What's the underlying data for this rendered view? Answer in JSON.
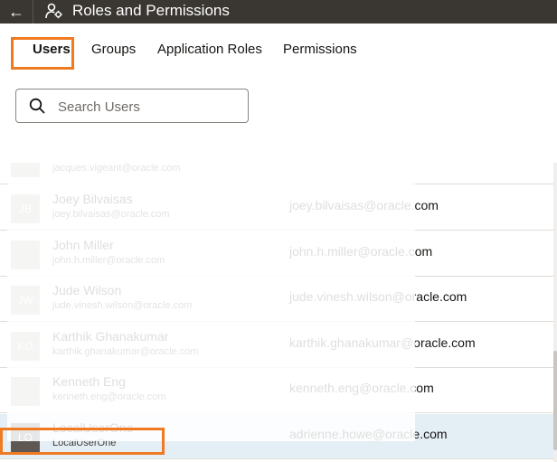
{
  "header": {
    "title": "Roles and Permissions",
    "back_icon": "arrow-left-icon",
    "title_icon": "roles-icon"
  },
  "tabs": [
    {
      "label": "Users",
      "active": true
    },
    {
      "label": "Groups",
      "active": false
    },
    {
      "label": "Application Roles",
      "active": false
    },
    {
      "label": "Permissions",
      "active": false
    }
  ],
  "search": {
    "placeholder": "Search Users",
    "value": ""
  },
  "users": [
    {
      "initials": "",
      "name": "",
      "sub": "jacques.vigeant@oracle.com",
      "email": ""
    },
    {
      "initials": "JB",
      "name": "Joey Bilvaisas",
      "sub": "joey.bilvaisas@oracle.com",
      "email": "joey.bilvaisas@oracle.com"
    },
    {
      "initials": "",
      "name": "John Miller",
      "sub": "john.h.miller@oracle.com",
      "email": "john.h.miller@oracle.com"
    },
    {
      "initials": "JW",
      "name": "Jude Wilson",
      "sub": "jude.vinesh.wilson@oracle.com",
      "email": "jude.vinesh.wilson@oracle.com"
    },
    {
      "initials": "KG",
      "name": "Karthik Ghanakumar",
      "sub": "karthik.ghanakumar@oracle.com",
      "email": "karthik.ghanakumar@oracle.com"
    },
    {
      "initials": "",
      "name": "Kenneth Eng",
      "sub": "kenneth.eng@oracle.com",
      "email": "kenneth.eng@oracle.com"
    },
    {
      "initials": "LO",
      "name": "LocalUserOne",
      "sub": "LocalUserOne",
      "email": "adrienne.howe@oracle.com"
    }
  ],
  "colors": {
    "accent_highlight": "#f07a22",
    "header_bg": "#3a3632",
    "selected_row_bg": "#e4eef5"
  }
}
